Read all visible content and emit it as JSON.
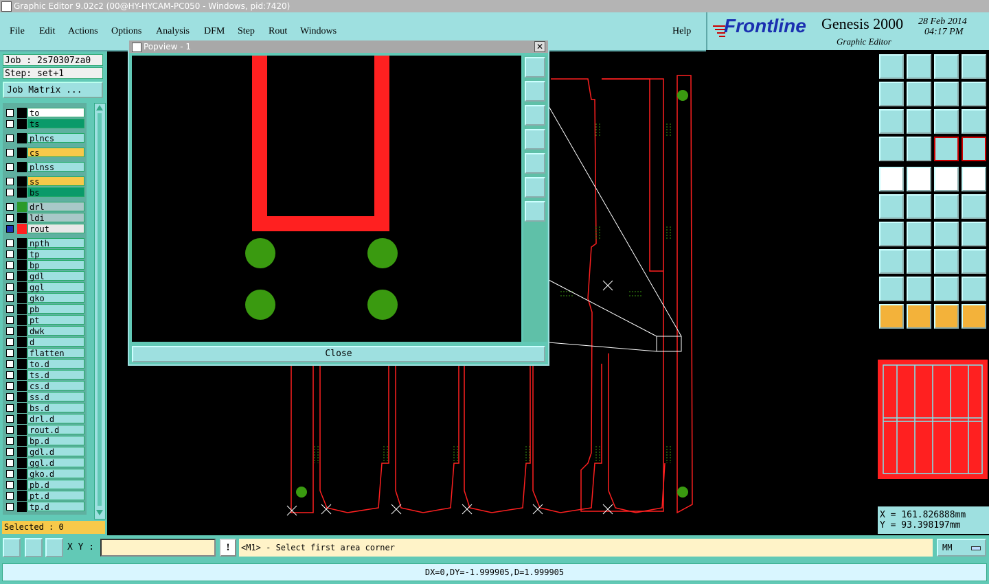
{
  "window": {
    "title": "Graphic Editor 9.02c2 (00@HY-HYCAM-PC050 - Windows, pid:7420)"
  },
  "menu": [
    {
      "label": "File"
    },
    {
      "label": "Edit"
    },
    {
      "label": "Actions"
    },
    {
      "label": "Options"
    },
    {
      "label": "Analysis"
    },
    {
      "label": "DFM"
    },
    {
      "label": "Step"
    },
    {
      "label": "Rout"
    },
    {
      "label": "Windows"
    },
    {
      "label": "Help"
    }
  ],
  "brand": {
    "logo": "Frontline",
    "product": "Genesis 2000",
    "subtitle": "Graphic Editor",
    "date": "28 Feb 2014",
    "time": "04:17 PM"
  },
  "job": {
    "job_label": "Job : 2s70307za0",
    "step_label": "Step: set+1",
    "matrix_button": "Job Matrix ..."
  },
  "layers": [
    {
      "name": "to",
      "color": "#ffffff"
    },
    {
      "name": "ts",
      "color": "#0a9a6a"
    },
    {
      "name": "plncs",
      "color": "#9ee0e0"
    },
    {
      "name": "cs",
      "color": "#f7c94a"
    },
    {
      "name": "plnss",
      "color": "#9ee0e0"
    },
    {
      "name": "ss",
      "color": "#f7c94a"
    },
    {
      "name": "bs",
      "color": "#0a9a6a"
    },
    {
      "name": "drl",
      "color": "#a8c8c8",
      "swatch": "#2a9a2a"
    },
    {
      "name": "ldi",
      "color": "#a8c8c8"
    },
    {
      "name": "rout",
      "color": "#e8e8e8",
      "swatch": "#ff2020",
      "active": true
    },
    {
      "name": "npth",
      "color": "#9ee0e0"
    },
    {
      "name": "tp",
      "color": "#9ee0e0"
    },
    {
      "name": "bp",
      "color": "#9ee0e0"
    },
    {
      "name": "gdl",
      "color": "#9ee0e0"
    },
    {
      "name": "ggl",
      "color": "#9ee0e0"
    },
    {
      "name": "gko",
      "color": "#9ee0e0"
    },
    {
      "name": "pb",
      "color": "#9ee0e0"
    },
    {
      "name": "pt",
      "color": "#9ee0e0"
    },
    {
      "name": "dwk",
      "color": "#9ee0e0"
    },
    {
      "name": "d",
      "color": "#9ee0e0"
    },
    {
      "name": "flatten",
      "color": "#9ee0e0"
    },
    {
      "name": "to.d",
      "color": "#9ee0e0"
    },
    {
      "name": "ts.d",
      "color": "#9ee0e0"
    },
    {
      "name": "cs.d",
      "color": "#9ee0e0"
    },
    {
      "name": "ss.d",
      "color": "#9ee0e0"
    },
    {
      "name": "bs.d",
      "color": "#9ee0e0"
    },
    {
      "name": "drl.d",
      "color": "#9ee0e0"
    },
    {
      "name": "rout.d",
      "color": "#9ee0e0"
    },
    {
      "name": "bp.d",
      "color": "#9ee0e0"
    },
    {
      "name": "gdl.d",
      "color": "#9ee0e0"
    },
    {
      "name": "ggl.d",
      "color": "#9ee0e0"
    },
    {
      "name": "gko.d",
      "color": "#9ee0e0"
    },
    {
      "name": "pb.d",
      "color": "#9ee0e0"
    },
    {
      "name": "pt.d",
      "color": "#9ee0e0"
    },
    {
      "name": "tp.d",
      "color": "#9ee0e0"
    }
  ],
  "selected": "Selected : 0",
  "popview": {
    "title": "Popview - 1",
    "close_label": "Close",
    "close_icon": "close-icon"
  },
  "coords": {
    "x": "X = 161.826888mm",
    "y": "Y = 93.398197mm"
  },
  "bottom": {
    "xy_label": "X Y :",
    "xy_value": "",
    "excl": "!",
    "prompt": "<M1> - Select first area corner",
    "units": "MM"
  },
  "status": "DX=0,DY=-1.999905,D=1.999905",
  "colors": {
    "panel": "#62c9b6",
    "button": "#9ee0e0",
    "rout": "#ff2020",
    "pad": "#3a9a10",
    "highlight": "#f3b23a"
  }
}
